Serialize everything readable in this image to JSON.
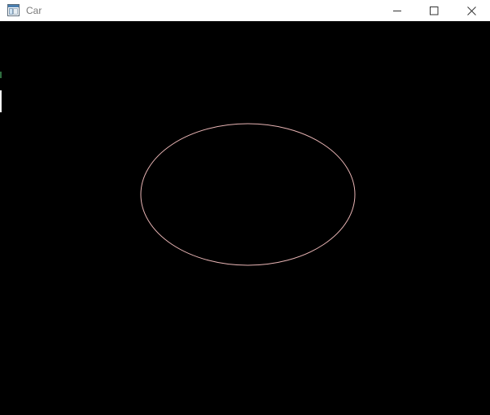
{
  "window": {
    "title": "Car",
    "app_icon": "window-app-icon",
    "controls": {
      "minimize_icon": "minimize-icon",
      "maximize_icon": "maximize-icon",
      "close_icon": "close-icon"
    }
  },
  "canvas": {
    "background_color": "#000000",
    "shape": {
      "kind": "ellipse-outline",
      "stroke_color": "#e8b4b4"
    }
  }
}
